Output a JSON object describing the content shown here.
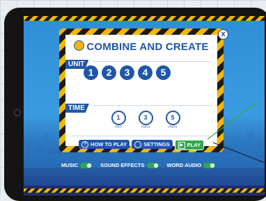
{
  "game": {
    "title": "COMBINE AND CREATE",
    "close_label": "x",
    "unit_label": "UNIT",
    "units": [
      "1",
      "2",
      "3",
      "4",
      "5"
    ],
    "time_label": "TIME",
    "timers": [
      {
        "value": "1",
        "unit": "min"
      },
      {
        "value": "3",
        "unit": "mins"
      },
      {
        "value": "5",
        "unit": "mins"
      }
    ],
    "buttons": {
      "how_to_play": "HOW TO PLAY",
      "settings": "SETTINGS",
      "play": "PLAY"
    },
    "toggles": {
      "music": "MUSIC",
      "sound_effects": "SOUND EFFECTS",
      "word_audio": "WORD AUDIO"
    }
  },
  "colors": {
    "brand_blue": "#1f56a8",
    "hazard_yellow": "#f2b705",
    "play_green": "#2fa84a"
  },
  "icons": [
    "emblem-icon",
    "question-icon",
    "gear-icon",
    "play-icon",
    "clock-icon",
    "close-icon"
  ]
}
